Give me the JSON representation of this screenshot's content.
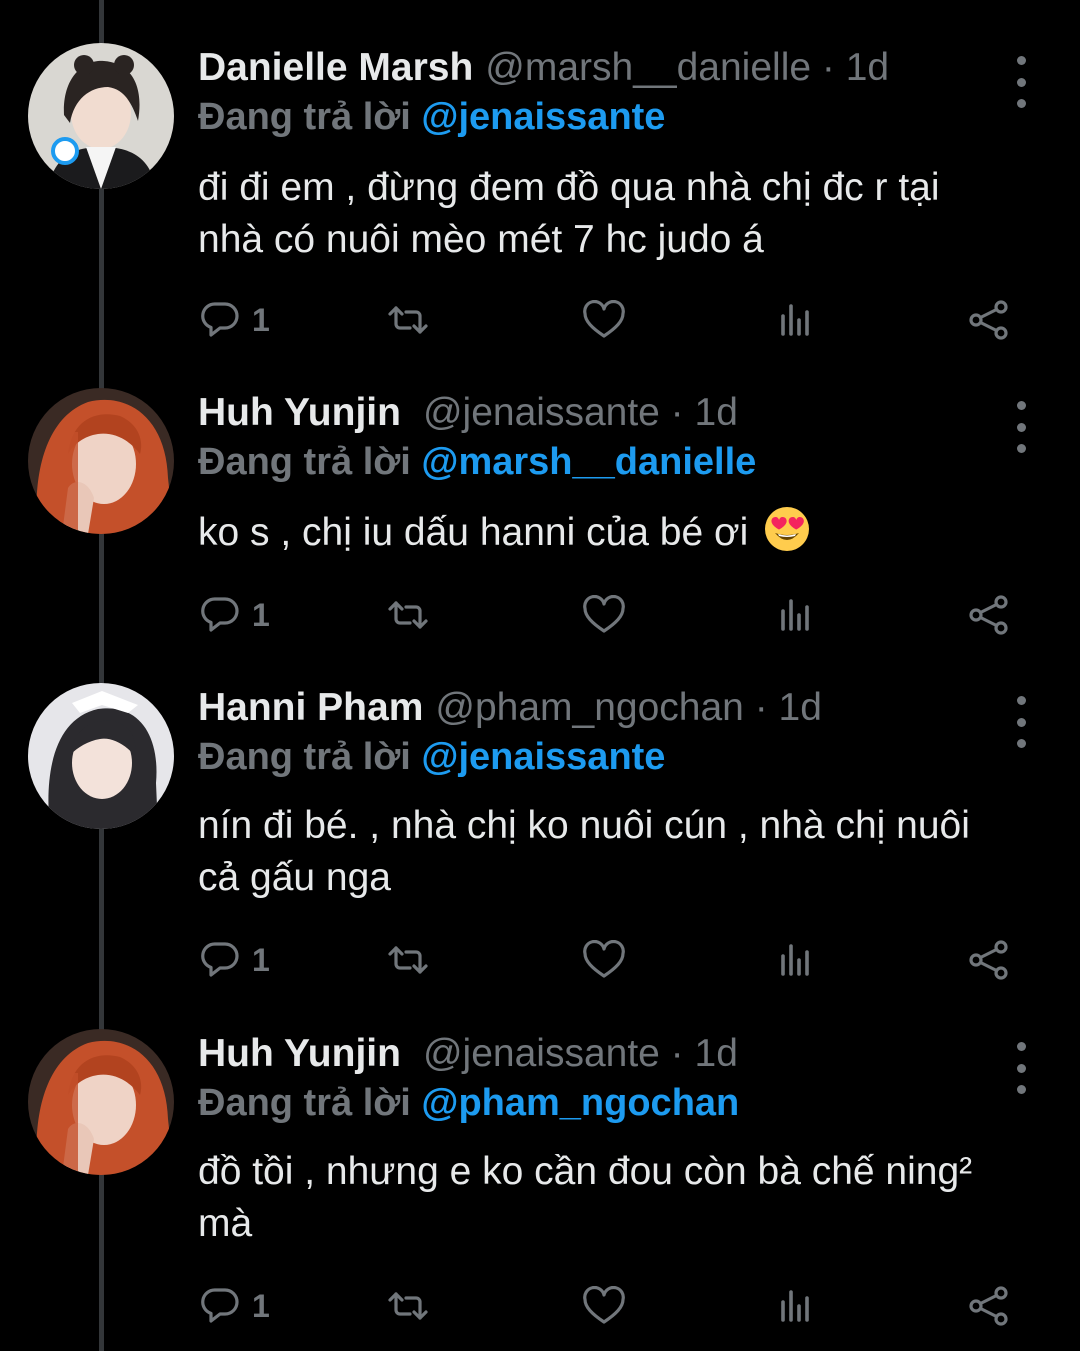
{
  "colors": {
    "background": "#000000",
    "accent": "#1d9bf0",
    "muted": "#71767b",
    "text": "#e7e9ea"
  },
  "reply_prefix": "Đang trả lời",
  "tweets": [
    {
      "name": "Danielle Marsh",
      "handle": "@marsh__danielle · 1d",
      "reply_to": "@jenaissante",
      "text_line1": "đi đi em , đừng đem đồ qua nhà chị đc r tại",
      "text_line2": "nhà có nuôi mèo mét 7 hc judo á",
      "reply_count": "1"
    },
    {
      "name": "Huh Yunjin",
      "handle": "@jenaissante · 1d",
      "reply_to": "@marsh__danielle",
      "text_line1": "ko s , chị iu dấu hanni của bé ơi",
      "emoji": "smiling-face-with-heart-eyes",
      "reply_count": "1"
    },
    {
      "name": "Hanni Pham",
      "handle": "@pham_ngochan · 1d",
      "reply_to": "@jenaissante",
      "text_line1": "nín đi bé. , nhà chị ko nuôi cún , nhà chị nuôi",
      "text_line2": "cả gấu nga",
      "reply_count": "1"
    },
    {
      "name": "Huh Yunjin",
      "handle": "@jenaissante · 1d",
      "reply_to": "@pham_ngochan",
      "text_line1": "đồ tồi , nhưng e ko cần đou còn bà chế ning²",
      "text_line2": "mà",
      "reply_count": "1"
    }
  ]
}
